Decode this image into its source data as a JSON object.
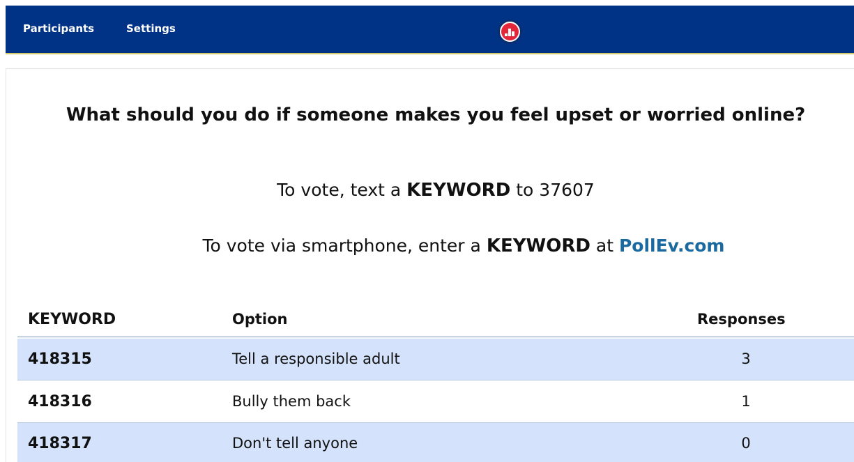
{
  "header": {
    "nav": [
      {
        "label": "Participants"
      },
      {
        "label": "Settings"
      }
    ],
    "logo_icon": "poll-everywhere-logo-icon",
    "background_color": "#003386"
  },
  "poll": {
    "question": "What should you do if someone makes you feel upset or worried online?",
    "text_vote": {
      "prefix": "To vote, text a",
      "keyword_word": "KEYWORD",
      "middle": "to",
      "number": "37607"
    },
    "web_vote": {
      "prefix": "To vote via smartphone, enter a",
      "keyword_word": "KEYWORD",
      "middle": "at",
      "site": "PollEv.com"
    }
  },
  "table": {
    "headers": {
      "keyword": "KEYWORD",
      "option": "Option",
      "responses": "Responses"
    },
    "rows": [
      {
        "keyword": "418315",
        "option": "Tell a responsible adult",
        "responses": "3"
      },
      {
        "keyword": "418316",
        "option": "Bully them back",
        "responses": "1"
      },
      {
        "keyword": "418317",
        "option": "Don't tell anyone",
        "responses": "0"
      }
    ],
    "shaded_row_color": "#d4e3fb"
  }
}
